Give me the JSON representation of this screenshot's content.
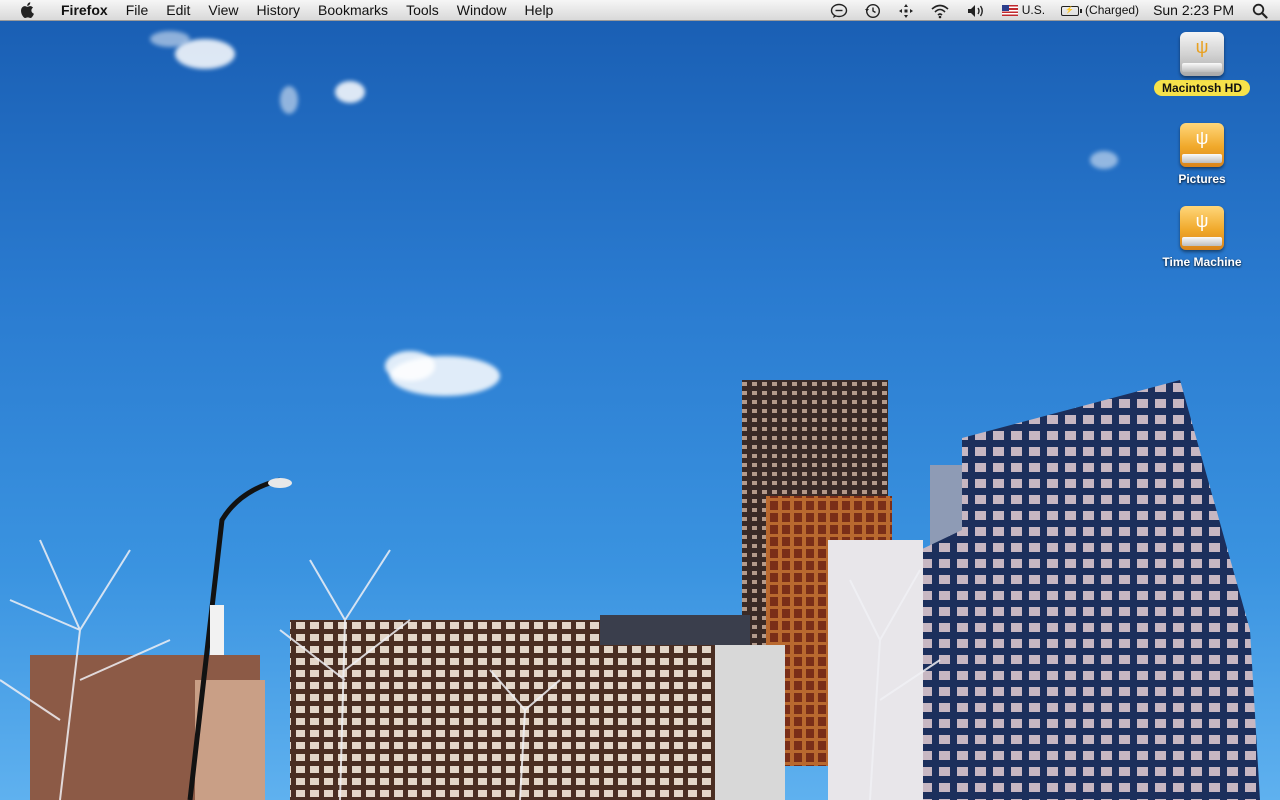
{
  "menubar": {
    "app_name": "Firefox",
    "items": [
      "File",
      "Edit",
      "View",
      "History",
      "Bookmarks",
      "Tools",
      "Window",
      "Help"
    ],
    "status": {
      "input_source": "U.S.",
      "battery": "(Charged)",
      "clock": "Sun 2:23 PM"
    }
  },
  "desktop": {
    "icons": [
      {
        "label": "Macintosh HD",
        "icon": "hard-drive-icon",
        "selected": true
      },
      {
        "label": "Pictures",
        "icon": "firewire-drive-icon",
        "selected": false
      },
      {
        "label": "Time Machine",
        "icon": "firewire-drive-icon",
        "selected": false
      }
    ]
  },
  "colors": {
    "sky_top": "#1a5fb4",
    "selected_label": "#f6e24a"
  }
}
